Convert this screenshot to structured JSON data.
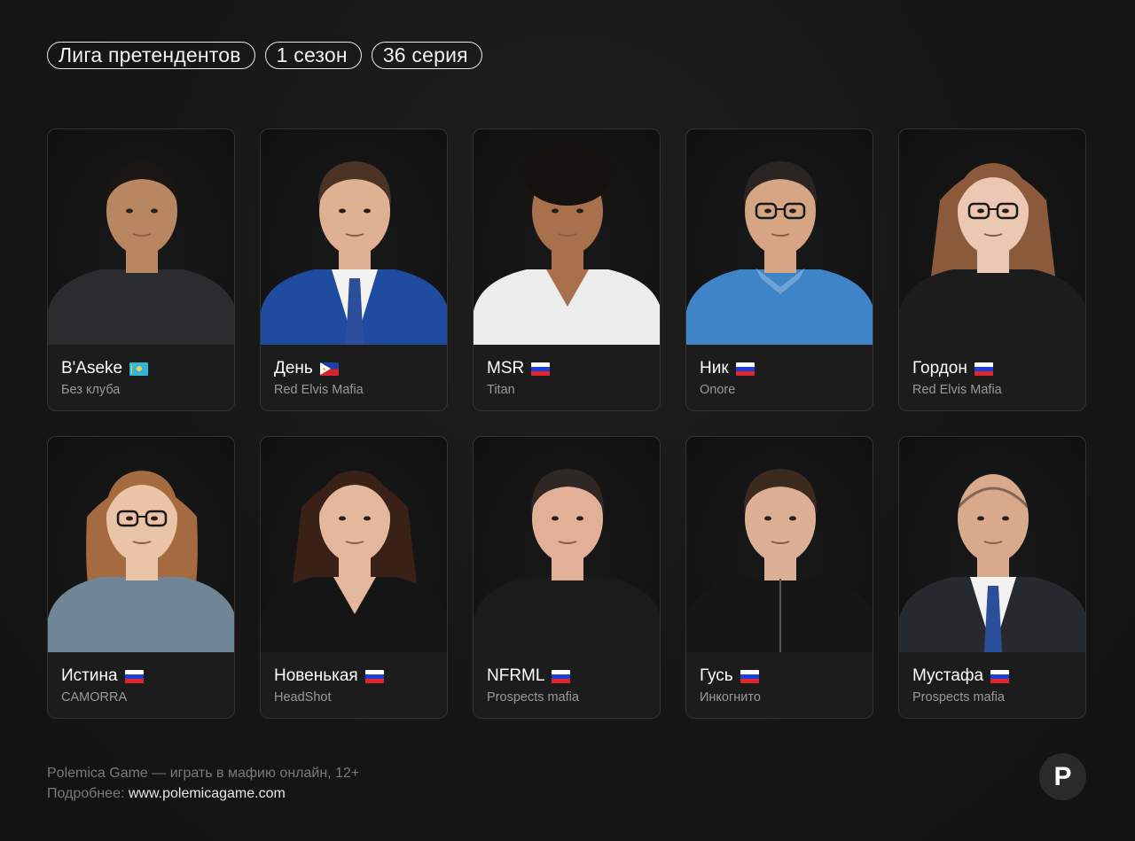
{
  "header": {
    "tags": [
      "Лига претендентов",
      "1 сезон",
      "36 серия"
    ]
  },
  "players": [
    {
      "name": "B'Aseke",
      "flag": "kz-flag",
      "club": "Без клуба",
      "skin": "#b98662",
      "hair": "#1a1614",
      "shirt": "#2a2c2e",
      "collar": "none",
      "hairstyle": "short",
      "glasses": false
    },
    {
      "name": "День",
      "flag": "ph-flag",
      "club": "Red Elvis Mafia",
      "skin": "#e0b093",
      "hair": "#4a3224",
      "shirt": "#1f4c9e",
      "collar": "suit-tie",
      "hairstyle": "short",
      "glasses": false
    },
    {
      "name": "MSR",
      "flag": "ru-flag",
      "club": "Titan",
      "skin": "#a9704e",
      "hair": "#161210",
      "shirt": "#ededed",
      "collar": "open",
      "hairstyle": "curly",
      "glasses": false
    },
    {
      "name": "Ник",
      "flag": "ru-flag",
      "club": "Onore",
      "skin": "#d6a585",
      "hair": "#2a2522",
      "shirt": "#3f84c7",
      "collar": "polo",
      "hairstyle": "short",
      "glasses": true
    },
    {
      "name": "Гордон",
      "flag": "ru-flag",
      "club": "Red Elvis Mafia",
      "skin": "#ecc8b3",
      "hair": "#8b5a3a",
      "shirt": "#1c1c1c",
      "collar": "none",
      "hairstyle": "long",
      "glasses": true
    },
    {
      "name": "Истина",
      "flag": "ru-flag",
      "club": "CAMORRA",
      "skin": "#ebc3a7",
      "hair": "#a66a41",
      "shirt": "#6f8696",
      "collar": "none",
      "hairstyle": "bob",
      "glasses": true
    },
    {
      "name": "Новенькая",
      "flag": "ru-flag",
      "club": "HeadShot",
      "skin": "#e4b89c",
      "hair": "#3a2118",
      "shirt": "#151515",
      "collar": "open",
      "hairstyle": "long",
      "glasses": false
    },
    {
      "name": "NFRML",
      "flag": "ru-flag",
      "club": "Prospects mafia",
      "skin": "#e2b096",
      "hair": "#2e2723",
      "shirt": "#1b1b1b",
      "collar": "none",
      "hairstyle": "short",
      "glasses": false
    },
    {
      "name": "Гусь",
      "flag": "ru-flag",
      "club": "Инкогнито",
      "skin": "#dcb095",
      "hair": "#3a2a20",
      "shirt": "#161616",
      "collar": "zip",
      "hairstyle": "short",
      "glasses": false
    },
    {
      "name": "Мустафа",
      "flag": "ru-flag",
      "club": "Prospects mafia",
      "skin": "#d9a98c",
      "hair": "#2a231f",
      "shirt": "#26292d",
      "collar": "suit-tie",
      "hairstyle": "bald",
      "glasses": false
    }
  ],
  "footer": {
    "line1": "Polemica Game — играть в мафию онлайн, 12+",
    "more_label": "Подробнее: ",
    "url": "www.polemicagame.com"
  },
  "logo": {
    "letter": "P",
    "icon": "polemica-logo-icon"
  },
  "colors": {
    "background": "#161616",
    "card": "#1c1c1c",
    "card_border": "#343434",
    "muted_text": "#9a9a9a"
  }
}
